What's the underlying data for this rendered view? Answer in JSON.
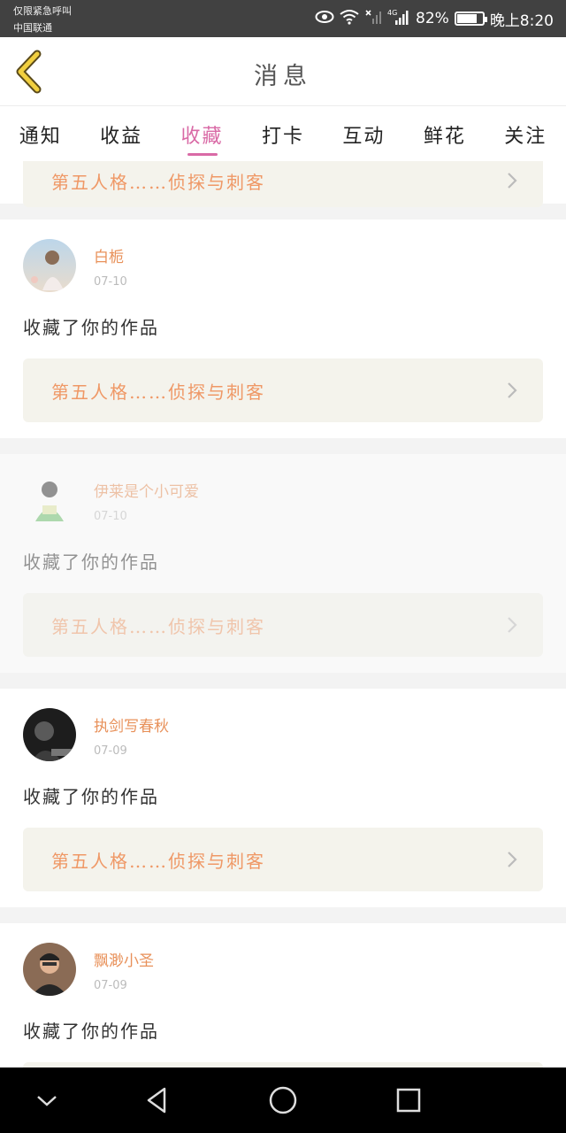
{
  "status_bar": {
    "carrier_line1": "仅限紧急呼叫",
    "carrier_line2": "中国联通",
    "network": "4G",
    "battery": "82%",
    "battery_level": 0.82,
    "time": "晚上8:20"
  },
  "header": {
    "title": "消息"
  },
  "tabs": [
    "通知",
    "收益",
    "收藏",
    "打卡",
    "互动",
    "鲜花",
    "关注"
  ],
  "active_tab": 2,
  "partial_card": {
    "link_text": "第五人格……侦探与刺客"
  },
  "messages": [
    {
      "name": "白栀",
      "date": "07-10",
      "action": "收藏了你的作品",
      "link_text": "第五人格……侦探与刺客"
    },
    {
      "name": "伊莱是个小可爱",
      "date": "07-10",
      "action": "收藏了你的作品",
      "link_text": "第五人格……侦探与刺客"
    },
    {
      "name": "执剑写春秋",
      "date": "07-09",
      "action": "收藏了你的作品",
      "link_text": "第五人格……侦探与刺客"
    },
    {
      "name": "飘渺小圣",
      "date": "07-09",
      "action": "收藏了你的作品",
      "link_text": ""
    }
  ],
  "colors": {
    "accent": "#d96aa6",
    "username": "#e8915a",
    "link_text": "#ef9866",
    "link_bg": "#f4f3ec"
  }
}
